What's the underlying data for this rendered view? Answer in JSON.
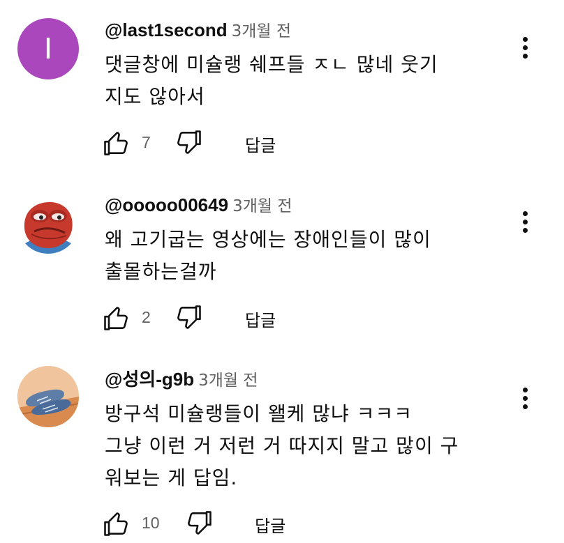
{
  "comments": [
    {
      "author": "@last1second",
      "time": "3개월 전",
      "avatar_letter": "I",
      "avatar_color": "#ab47bc",
      "text_lines": [
        "댓글창에 미슐랭 쉐프들 ㅈㄴ 많네 웃기",
        "지도 않아서"
      ],
      "likes": "7",
      "reply_label": "답글"
    },
    {
      "author": "@ooooo00649",
      "time": "3개월 전",
      "avatar_image": "pepe-frog",
      "text_lines": [
        "왜 고기굽는 영상에는 장애인들이 많이",
        "출몰하는걸까"
      ],
      "likes": "2",
      "reply_label": "답글"
    },
    {
      "author": "@성의-g9b",
      "time": "3개월 전",
      "avatar_image": "blue-shoes",
      "text_lines": [
        "방구석 미슐랭들이 왤케 많냐 ㅋㅋㅋ",
        "그냥 이런 거 저런 거 따지지 말고 많이 구",
        "워보는 게 답임."
      ],
      "likes": "10",
      "reply_label": "답글"
    }
  ],
  "icons": {
    "like": "thumbs-up-icon",
    "dislike": "thumbs-down-icon",
    "more": "more-vert-icon"
  }
}
